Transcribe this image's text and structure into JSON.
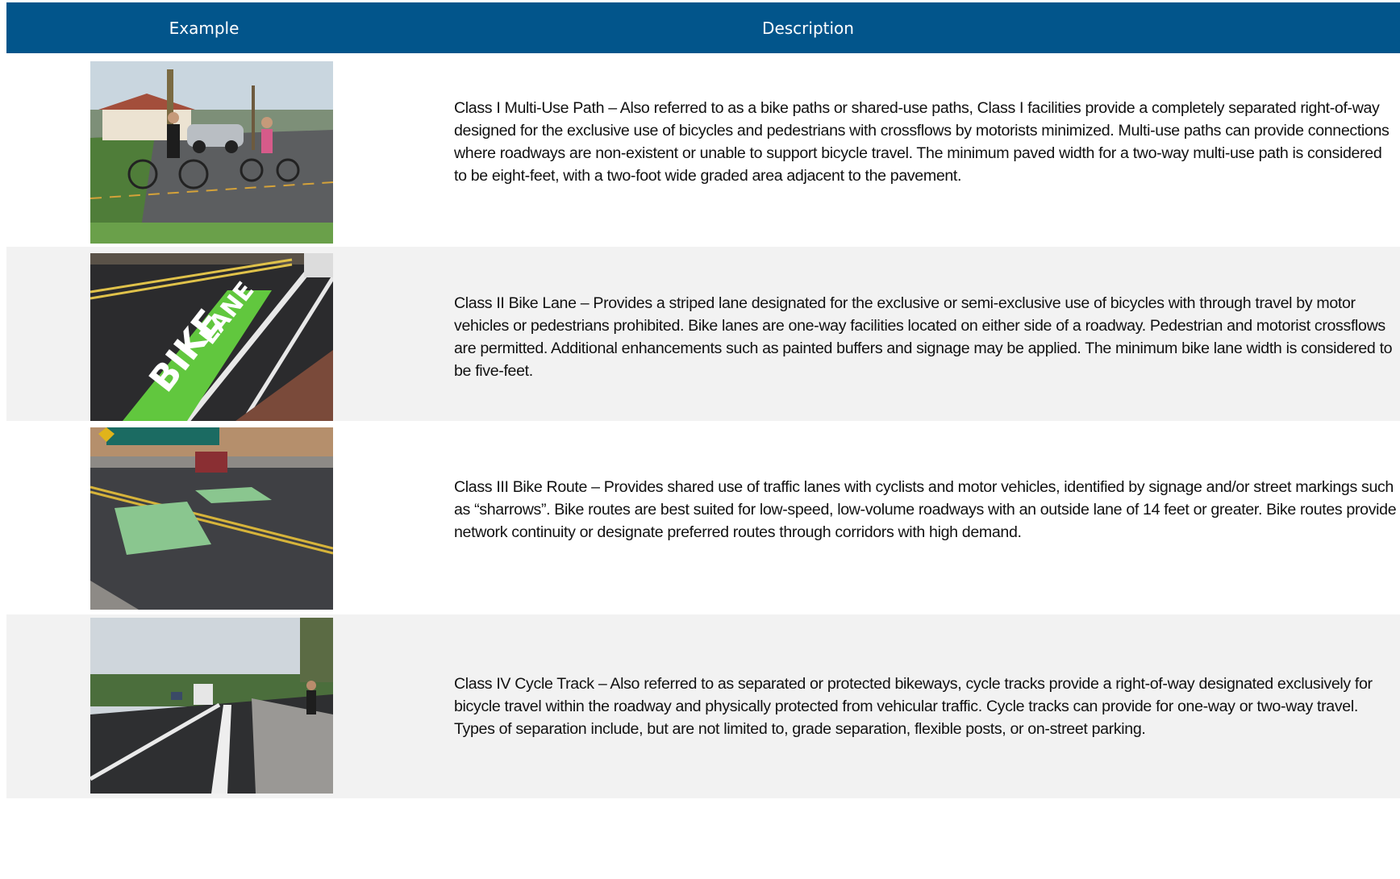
{
  "header": {
    "col_example": "Example",
    "col_description": "Description"
  },
  "rows": [
    {
      "photo": "cyclists-on-multi-use-path-photo",
      "text": "Class I Multi-Use Path – Also referred to as a bike paths or shared-use paths, Class I facilities provide a completely separated right-of-way designed for the exclusive use of bicycles and pedestrians with crossflows by motorists minimized.  Multi-use paths can provide connections where roadways are non-existent or unable to support bicycle travel.  The minimum paved width for a two-way multi-use path is considered to be eight-feet, with a two-foot wide graded area adjacent to the pavement."
    },
    {
      "photo": "green-bike-lane-marking-photo",
      "text": "Class II Bike Lane – Provides a striped lane designated for the exclusive or semi-exclusive use of bicycles with through travel by motor vehicles or pedestrians prohibited.  Bike lanes are one-way facilities located on either side of a roadway.  Pedestrian and motorist crossflows are permitted.  Additional enhancements such as painted buffers and signage may be applied.  The minimum bike lane width is considered to be five-feet."
    },
    {
      "photo": "sharrow-street-markings-photo",
      "text": "Class III Bike Route – Provides shared use of traffic lanes with cyclists and motor vehicles, identified by signage and/or street markings such as “sharrows”.  Bike routes are best suited for low-speed, low-volume roadways with an outside lane of 14 feet or greater. Bike routes provide network continuity or designate preferred routes through corridors with high demand."
    },
    {
      "photo": "separated-cycle-track-photo",
      "text": "Class IV Cycle Track – Also referred to as separated or protected bikeways, cycle tracks provide a right-of-way designated exclusively for bicycle travel within the roadway and physically protected from vehicular traffic.  Cycle tracks can provide for one-way or two-way travel. Types of separation include, but are not limited to, grade separation, flexible posts, or on-street parking."
    }
  ],
  "colors": {
    "header_bg": "#02558b",
    "row_shade": "#f2f2f2"
  }
}
